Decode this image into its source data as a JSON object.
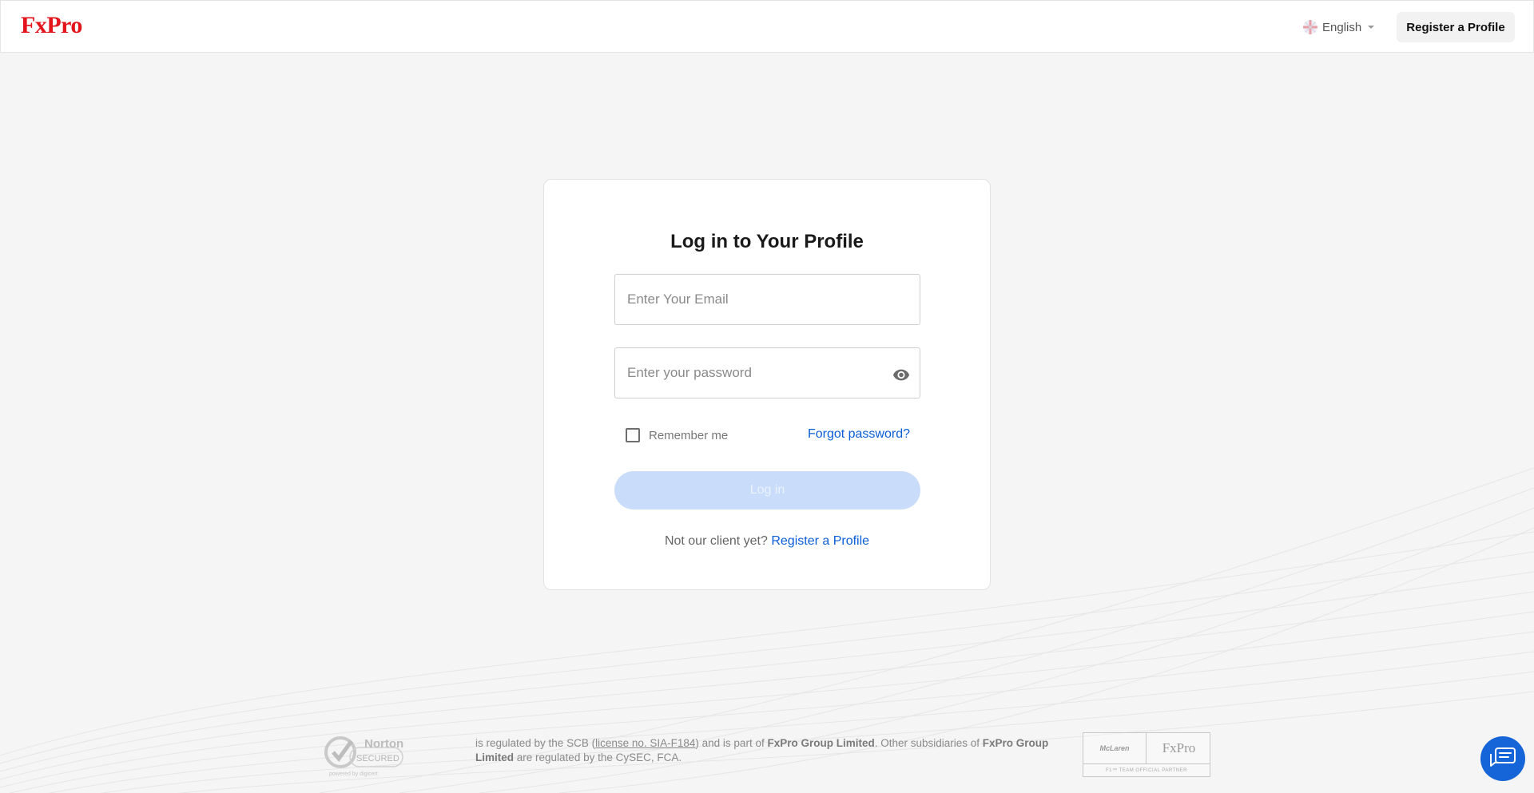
{
  "header": {
    "logo": "FxPro",
    "language": "English",
    "register_label": "Register a Profile"
  },
  "login": {
    "title": "Log in to Your Profile",
    "email_placeholder": "Enter Your Email",
    "password_placeholder": "Enter your password",
    "remember_label": "Remember me",
    "forgot_label": "Forgot password?",
    "login_label": "Log in",
    "not_client_text": "Not our client yet?",
    "register_link": "Register a Profile"
  },
  "footer": {
    "norton_title": "Norton",
    "norton_sub": "SECURED",
    "norton_by": "powered by digicert",
    "text_1": "is regulated by the SCB (",
    "license": "license no. SIA-F184",
    "text_2": ") and is part of ",
    "group_1": "FxPro Group Limited",
    "text_3": ". Other subsidiaries of ",
    "group_2": "FxPro Group Limited",
    "text_4": " are regulated by the CySEC, FCA.",
    "partner_left": "McLaren",
    "partner_right": "FxPro",
    "partner_bottom": "F1™ TEAM OFFICIAL PARTNER"
  },
  "colors": {
    "brand_red": "#e3141b",
    "link_blue": "#0a5ed7",
    "button_disabled": "#c9dcfa",
    "chat_blue": "#1565d8"
  },
  "icons": {
    "language": "uk-flag-icon",
    "password_toggle": "eye-icon",
    "chat": "chat-icon"
  }
}
